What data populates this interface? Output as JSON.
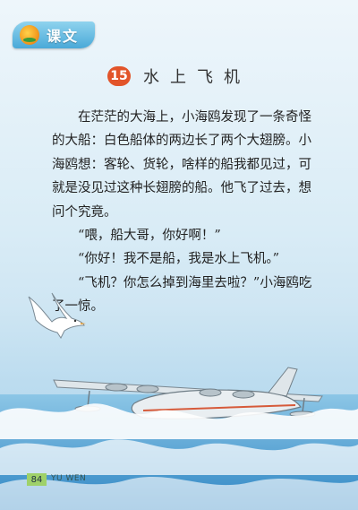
{
  "header": {
    "section_label": "课文"
  },
  "lesson": {
    "number": "15",
    "title": "水上飞机"
  },
  "body": {
    "paragraphs": [
      "在茫茫的大海上，小海鸥发现了一条奇怪的大船：白色船体的两边长了两个大翅膀。小海鸥想：客轮、货轮，啥样的船我都见过，可就是没见过这种长翅膀的船。他飞了过去，想问个究竟。",
      "“喂，船大哥，你好啊！”",
      "“你好！我不是船，我是水上飞机。”",
      "“飞机？你怎么掉到海里去啦？”小海鸥吃了一惊。"
    ]
  },
  "footer": {
    "page_number": "84",
    "label": "YU WEN"
  },
  "colors": {
    "accent": "#e2542a",
    "badge": "#4aa9d8",
    "page_tab": "#9fd16a"
  },
  "icons": {
    "badge_logo": "sun-leaf-logo-icon",
    "bird": "seagull-icon"
  }
}
